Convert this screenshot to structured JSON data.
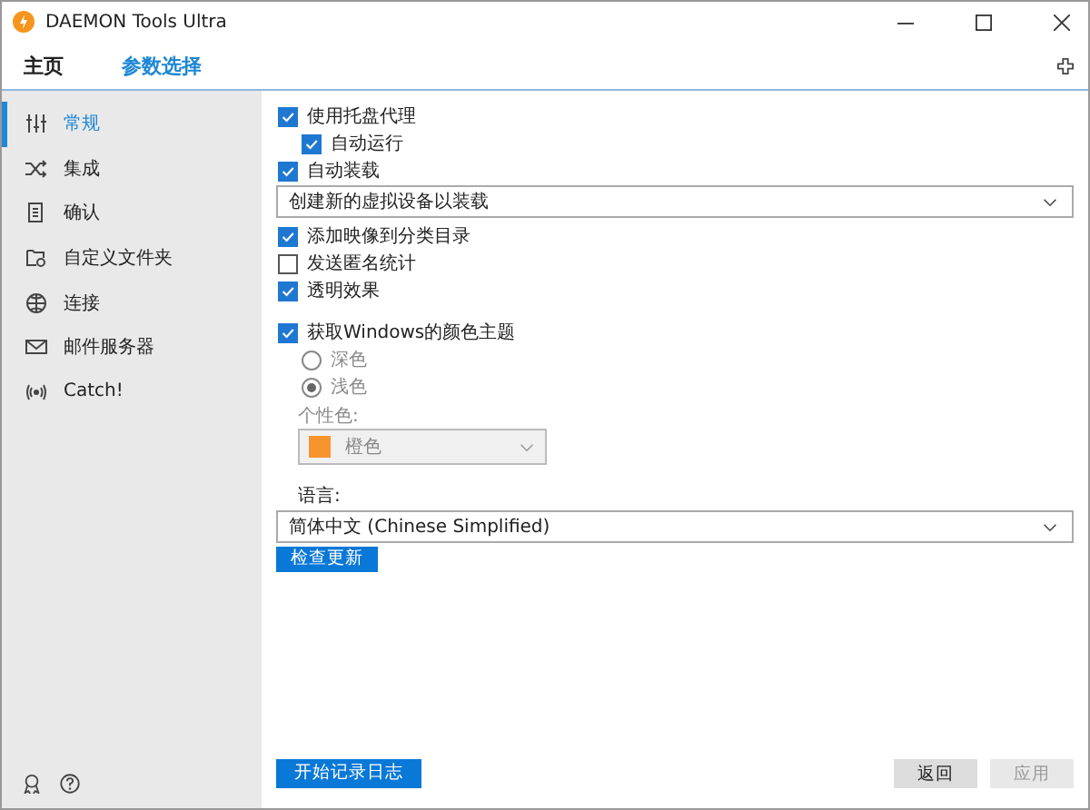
{
  "window": {
    "title": "DAEMON Tools Ultra"
  },
  "tabs": [
    {
      "label": "主页",
      "selected": false
    },
    {
      "label": "参数选择",
      "selected": true
    }
  ],
  "sidebar": {
    "items": [
      {
        "label": "常规",
        "selected": true
      },
      {
        "label": "集成",
        "selected": false
      },
      {
        "label": "确认",
        "selected": false
      },
      {
        "label": "自定义文件夹",
        "selected": false
      },
      {
        "label": "连接",
        "selected": false
      },
      {
        "label": "邮件服务器",
        "selected": false
      },
      {
        "label": "Catch!",
        "selected": false
      }
    ]
  },
  "settings": [
    {
      "kind": "checkbox",
      "label": "使用托盘代理",
      "checked": true,
      "indent": false
    },
    {
      "kind": "checkbox",
      "label": "自动运行",
      "checked": true,
      "indent": true
    },
    {
      "kind": "checkbox",
      "label": "自动装载",
      "checked": true,
      "indent": false
    },
    {
      "kind": "select",
      "value": "创建新的虚拟设备以装载"
    },
    {
      "kind": "checkbox",
      "label": "添加映像到分类目录",
      "checked": true,
      "indent": false
    },
    {
      "kind": "checkbox",
      "label": "发送匿名统计",
      "checked": false,
      "indent": false
    },
    {
      "kind": "checkbox",
      "label": "透明效果",
      "checked": true,
      "indent": false
    },
    {
      "kind": "gap"
    },
    {
      "kind": "checkbox",
      "label": "获取Windows的颜色主题",
      "checked": true,
      "indent": false
    },
    {
      "kind": "radio",
      "label": "深色",
      "selected": false
    },
    {
      "kind": "radio",
      "label": "浅色",
      "selected": true
    },
    {
      "kind": "label",
      "label": "个性色:",
      "disabled": true
    },
    {
      "kind": "color",
      "value": "橙色",
      "color": "#f7942e"
    },
    {
      "kind": "gap"
    },
    {
      "kind": "label",
      "label": "语言:",
      "disabled": false
    },
    {
      "kind": "select",
      "value": "简体中文 (Chinese Simplified)"
    },
    {
      "kind": "button",
      "label": "检查更新"
    }
  ],
  "footer": {
    "log_button": "开始记录日志",
    "back_button": "返回",
    "apply_button": "应用",
    "apply_disabled": true
  }
}
